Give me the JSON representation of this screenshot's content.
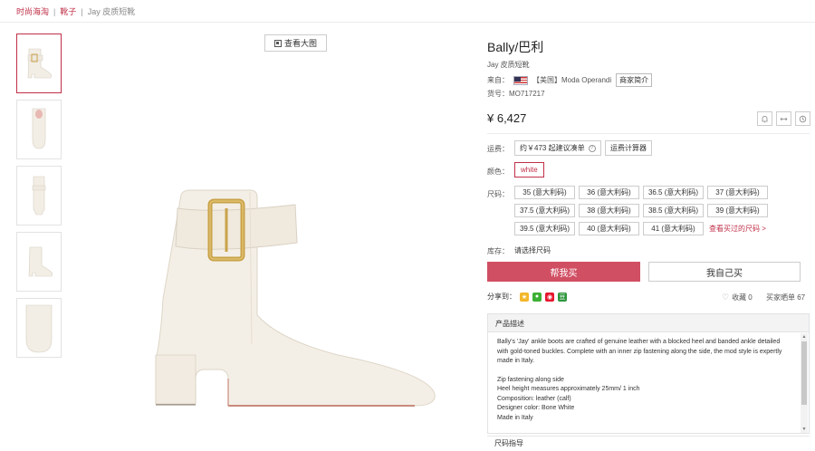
{
  "breadcrumb": {
    "home": "时尚海淘",
    "category": "靴子",
    "current": "Jay 皮质短靴"
  },
  "gallery": {
    "view_large": "查看大图"
  },
  "product": {
    "brand": "Bally/巴利",
    "name": "Jay 皮质短靴",
    "source_label": "来自：",
    "source_name": "【美国】Moda Operandi",
    "merchant_btn": "商家简介",
    "sku_label": "货号：",
    "sku": "MO717217",
    "price": "¥ 6,427"
  },
  "shipping": {
    "label": "运费：",
    "value": "约￥473 起建议凑单",
    "calc": "运费计算器"
  },
  "color": {
    "label": "颜色：",
    "selected": "white"
  },
  "sizes": {
    "label": "尺码：",
    "options": [
      "35 (意大利码)",
      "36 (意大利码)",
      "36.5 (意大利码)",
      "37 (意大利码)",
      "37.5 (意大利码)",
      "38 (意大利码)",
      "38.5 (意大利码)",
      "39 (意大利码)",
      "39.5 (意大利码)",
      "40 (意大利码)",
      "41 (意大利码)"
    ],
    "history_link": "查看买过的尺码 >"
  },
  "stock": {
    "label": "库存：",
    "value": "请选择尺码"
  },
  "actions": {
    "buy_for_me": "帮我买",
    "self_buy": "我自己买"
  },
  "share": {
    "label": "分享到：",
    "fav_label": "收藏 0",
    "buyers_label": "买家晒单 67"
  },
  "description": {
    "title": "产品描述",
    "para1": "Bally's 'Jay' ankle boots are crafted of genuine leather with a blocked heel and banded ankle detailed with gold-toned buckles. Complete with an inner zip fastening along the side, the mod style is expertly made in Italy.",
    "lines": [
      "Zip fastening along side",
      "Heel height measures approximately 25mm/ 1 inch",
      "Composition: leather (calf)",
      "Designer color: Bone White",
      "Made in Italy"
    ]
  },
  "size_guide": "尺码指导",
  "colors": {
    "accent": "#c03048",
    "buy_button": "#d14f63"
  },
  "icons": [
    "view-large-icon",
    "bell-icon",
    "compare-icon",
    "clock-icon",
    "help-icon",
    "star-icon",
    "wechat-icon",
    "weibo-icon",
    "douban-icon",
    "heart-icon"
  ]
}
